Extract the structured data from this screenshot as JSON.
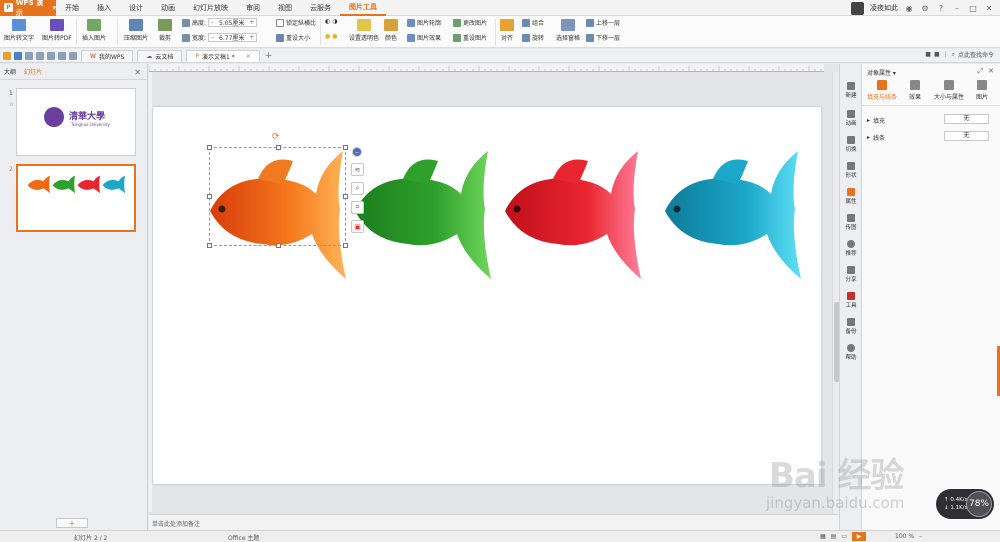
{
  "menubar": {
    "app_name": "WPS 演示",
    "logo_glyph": "P",
    "tabs": [
      "开始",
      "插入",
      "设计",
      "动画",
      "幻灯片放映",
      "审阅",
      "视图",
      "云服务",
      "图片工具"
    ],
    "active_tab": "图片工具",
    "user_name": "凌夜如此"
  },
  "ribbon": {
    "img_to_text": "图片转文字",
    "img_to_pdf": "图片转PDF",
    "insert_image": "插入图片",
    "compress_image": "压缩图片",
    "crop": "裁剪",
    "height_label": "高度:",
    "height_value": "5.05厘米",
    "width_label": "宽度:",
    "width_value": "6.77厘米",
    "lock_ratio": "锁定纵横比",
    "reset_size": "重设大小",
    "set_transparent": "设置透明色",
    "color": "颜色",
    "img_outline": "图片轮廓",
    "img_effect": "图片效果",
    "change_img": "更改图片",
    "reset_img": "重设图片",
    "align": "对齐",
    "group": "组合",
    "rotate": "旋转",
    "selection_pane": "选择窗格",
    "bring_forward": "上移一层",
    "send_backward": "下移一层"
  },
  "tabstrip": {
    "tabs": [
      "我的WPS",
      "云文档",
      "演示文稿1 *"
    ],
    "search_label": "点此查找命令"
  },
  "leftpanel": {
    "tab_outline": "大纲",
    "tab_slides": "幻灯片",
    "slide_numbers": [
      "1",
      "2"
    ]
  },
  "slide1": {
    "logo_cn": "清華大學",
    "logo_en": "Tsinghua University"
  },
  "notes_placeholder": "单击此处添加备注",
  "rightbar": {
    "items": [
      "新建",
      "动画",
      "切换",
      "形状",
      "属性",
      "传图",
      "推荐",
      "分享",
      "工具",
      "备份",
      "帮助"
    ]
  },
  "props": {
    "title": "对象属性",
    "tabs": [
      "填充与线条",
      "效果",
      "大小与属性",
      "图片"
    ],
    "fill_label": "填充",
    "fill_value": "无",
    "line_label": "线条",
    "line_value": "无"
  },
  "statusbar": {
    "slide_info": "幻灯片 2 / 2",
    "theme": "Office 主题",
    "zoom": "100 %"
  },
  "perf": {
    "up": "0.4K/s",
    "down": "1.1K/s",
    "cpu": "78%"
  },
  "watermark": {
    "brand": "Bai 经验",
    "url": "jingyan.baidu.com"
  },
  "colors": {
    "accent": "#e8731d",
    "fish_orange": "#f06a12",
    "fish_green": "#2ea12c",
    "fish_red": "#e9252f",
    "fish_cyan": "#1ba7c9"
  }
}
